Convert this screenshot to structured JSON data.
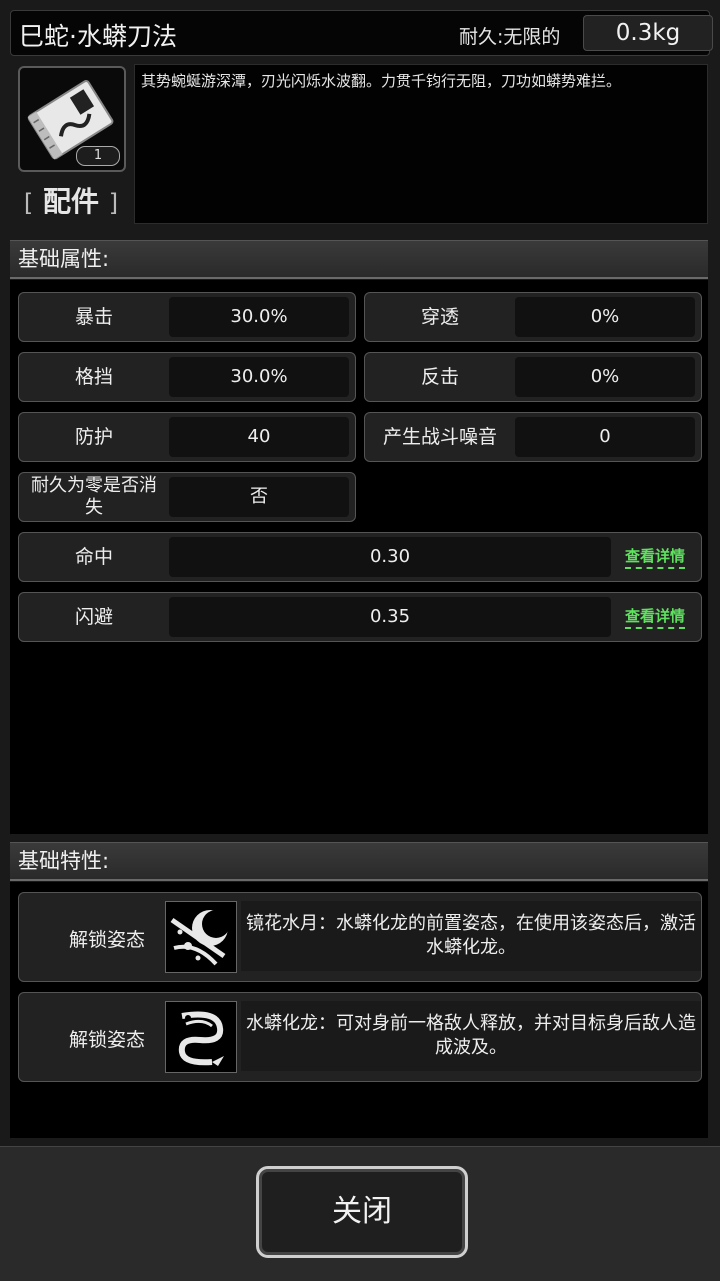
{
  "header": {
    "item_name": "巳蛇·水蟒刀法",
    "durability_label": "耐久:无限的",
    "weight": "0.3kg"
  },
  "item": {
    "icon": "scroll-manual-icon",
    "count": "1",
    "type_label": "配件",
    "type_bracket_left": "[",
    "type_bracket_right": "]",
    "description": "其势蜿蜒游深潭，刃光闪烁水波翻。力贯千钧行无阻，刀功如蟒势难拦。"
  },
  "basic_attributes": {
    "title": "基础属性:",
    "stats": [
      {
        "label": "暴击",
        "value": "30.0%"
      },
      {
        "label": "穿透",
        "value": "0%"
      },
      {
        "label": "格挡",
        "value": "30.0%"
      },
      {
        "label": "反击",
        "value": "0%"
      },
      {
        "label": "防护",
        "value": "40"
      },
      {
        "label": "产生战斗噪音",
        "value": "0"
      },
      {
        "label": "耐久为零是否消失",
        "value": "否"
      }
    ],
    "wide_stats": [
      {
        "label": "命中",
        "value": "0.30",
        "link": "查看详情"
      },
      {
        "label": "闪避",
        "value": "0.35",
        "link": "查看详情"
      }
    ]
  },
  "basic_traits": {
    "title": "基础特性:",
    "traits": [
      {
        "label": "解锁姿态",
        "icon": "moon-stance-icon",
        "desc": "镜花水月：水蟒化龙的前置姿态，在使用该姿态后，激活水蟒化龙。"
      },
      {
        "label": "解锁姿态",
        "icon": "serpent-dragon-icon",
        "desc": "水蟒化龙：可对身前一格敌人释放，并对目标身后敌人造成波及。"
      }
    ]
  },
  "footer": {
    "close_label": "关闭"
  },
  "colors": {
    "link": "#5fe05f",
    "panel_bg": "#000000",
    "cell_bg": "#222222"
  }
}
